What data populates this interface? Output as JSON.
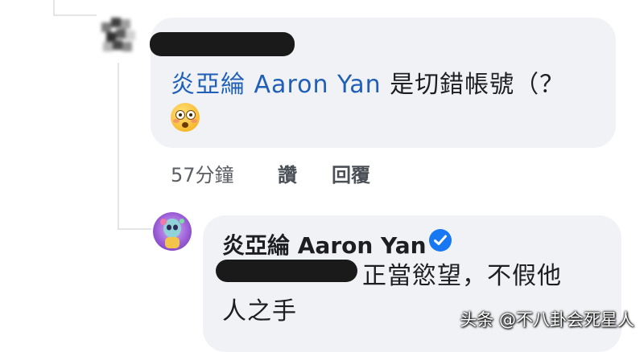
{
  "comment": {
    "mention": "炎亞綸 Aaron Yan",
    "text": " 是切錯帳號（？",
    "emoji": "flushed-face",
    "time": "57分鐘",
    "like_label": "讚",
    "reply_label": "回覆"
  },
  "reply": {
    "author": "炎亞綸 Aaron Yan",
    "line1": "正當慾望，不假他",
    "line2": "人之手"
  },
  "watermark": "头条 @不八卦会死星人",
  "colors": {
    "mention": "#1f5fb8",
    "bubble": "#f0f2f5",
    "verified": "#1877f2"
  }
}
